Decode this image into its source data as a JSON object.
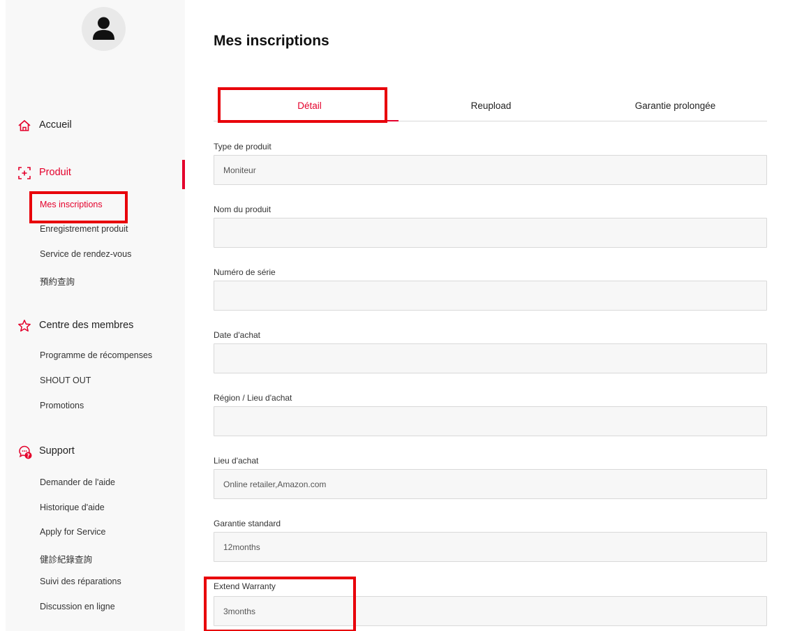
{
  "sidebar": {
    "sections": [
      {
        "label": "Accueil",
        "icon": "home-icon",
        "items": []
      },
      {
        "label": "Produit",
        "icon": "product-icon",
        "items": [
          "Mes inscriptions",
          "Enregistrement produit",
          "Service de rendez-vous",
          "預約查詢"
        ]
      },
      {
        "label": "Centre des membres",
        "icon": "star-icon",
        "items": [
          "Programme de récompenses",
          "SHOUT OUT",
          "Promotions"
        ]
      },
      {
        "label": "Support",
        "icon": "support-chat-icon",
        "items": [
          "Demander de l'aide",
          "Historique d'aide",
          "Apply for Service",
          "健診紀錄查詢",
          "Suivi des réparations",
          "Discussion en ligne"
        ]
      }
    ],
    "active_section": "Produit",
    "active_item": "Mes inscriptions"
  },
  "main": {
    "title": "Mes inscriptions",
    "tabs": [
      "Détail",
      "Reupload",
      "Garantie prolongée"
    ],
    "active_tab": "Détail",
    "fields": [
      {
        "label": "Type de produit",
        "value": "Moniteur"
      },
      {
        "label": "Nom du produit",
        "value": ""
      },
      {
        "label": "Numéro de série",
        "value": ""
      },
      {
        "label": "Date d'achat",
        "value": ""
      },
      {
        "label": "Région / Lieu d'achat",
        "value": ""
      },
      {
        "label": "Lieu d'achat",
        "value": "Online retailer,Amazon.com"
      },
      {
        "label": "Garantie standard",
        "value": "12months"
      },
      {
        "label": "Extend Warranty",
        "value": "3months"
      }
    ]
  },
  "colors": {
    "accent": "#e4002b",
    "annotation": "#e8000a",
    "sidebar_bg": "#f8f8f8",
    "input_bg": "#f7f7f7"
  }
}
